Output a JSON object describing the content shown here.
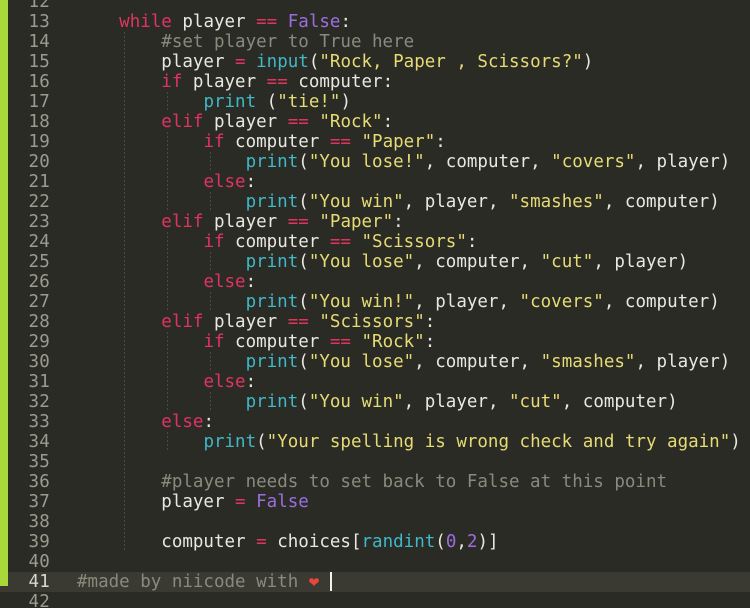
{
  "editor": {
    "language": "Python",
    "theme_name": "dark-olive",
    "background_color": "#2b2b26",
    "active_line_background": "#3a3a33",
    "accent_bar_color": "#a8d839",
    "gutter_color": "#9b9b8e",
    "caret_color": "#f2f2ea",
    "active_line_number": 41,
    "first_visible_line": 12,
    "last_visible_line": 42,
    "palette": {
      "plain": "#e8e8e0",
      "keyword": "#e0345e",
      "builtin": "#3fb8c8",
      "string": "#e6db74",
      "number": "#9b6ee0",
      "constant": "#9b6ee0",
      "operator": "#e0345e",
      "comment": "#8a8a7c",
      "emoji": "#e8453c"
    }
  },
  "lines": [
    {
      "number": "12",
      "indent_guides": [],
      "tokens": []
    },
    {
      "number": "13",
      "indent_guides": [],
      "tokens": [
        {
          "t": "plain",
          "v": "    "
        },
        {
          "t": "keyword",
          "v": "while"
        },
        {
          "t": "plain",
          "v": " player "
        },
        {
          "t": "operator",
          "v": "=="
        },
        {
          "t": "plain",
          "v": " "
        },
        {
          "t": "constant",
          "v": "False"
        },
        {
          "t": "punct",
          "v": ":"
        }
      ]
    },
    {
      "number": "14",
      "indent_guides": [
        124
      ],
      "tokens": [
        {
          "t": "plain",
          "v": "        "
        },
        {
          "t": "comment",
          "v": "#set player to True here"
        }
      ]
    },
    {
      "number": "15",
      "indent_guides": [
        124
      ],
      "tokens": [
        {
          "t": "plain",
          "v": "        player "
        },
        {
          "t": "operator",
          "v": "="
        },
        {
          "t": "plain",
          "v": " "
        },
        {
          "t": "builtin",
          "v": "input"
        },
        {
          "t": "punct",
          "v": "("
        },
        {
          "t": "string",
          "v": "\"Rock, Paper , Scissors?\""
        },
        {
          "t": "punct",
          "v": ")"
        }
      ]
    },
    {
      "number": "16",
      "indent_guides": [
        124
      ],
      "tokens": [
        {
          "t": "plain",
          "v": "        "
        },
        {
          "t": "keyword",
          "v": "if"
        },
        {
          "t": "plain",
          "v": " player "
        },
        {
          "t": "operator",
          "v": "=="
        },
        {
          "t": "plain",
          "v": " computer"
        },
        {
          "t": "punct",
          "v": ":"
        }
      ]
    },
    {
      "number": "17",
      "indent_guides": [
        124,
        167
      ],
      "tokens": [
        {
          "t": "plain",
          "v": "            "
        },
        {
          "t": "builtin",
          "v": "print"
        },
        {
          "t": "plain",
          "v": " "
        },
        {
          "t": "punct",
          "v": "("
        },
        {
          "t": "string",
          "v": "\"tie!\""
        },
        {
          "t": "punct",
          "v": ")"
        }
      ]
    },
    {
      "number": "18",
      "indent_guides": [
        124
      ],
      "tokens": [
        {
          "t": "plain",
          "v": "        "
        },
        {
          "t": "keyword",
          "v": "elif"
        },
        {
          "t": "plain",
          "v": " player "
        },
        {
          "t": "operator",
          "v": "=="
        },
        {
          "t": "plain",
          "v": " "
        },
        {
          "t": "string",
          "v": "\"Rock\""
        },
        {
          "t": "punct",
          "v": ":"
        }
      ]
    },
    {
      "number": "19",
      "indent_guides": [
        124,
        167
      ],
      "tokens": [
        {
          "t": "plain",
          "v": "            "
        },
        {
          "t": "keyword",
          "v": "if"
        },
        {
          "t": "plain",
          "v": " computer "
        },
        {
          "t": "operator",
          "v": "=="
        },
        {
          "t": "plain",
          "v": " "
        },
        {
          "t": "string",
          "v": "\"Paper\""
        },
        {
          "t": "punct",
          "v": ":"
        }
      ]
    },
    {
      "number": "20",
      "indent_guides": [
        124,
        167,
        210
      ],
      "tokens": [
        {
          "t": "plain",
          "v": "                "
        },
        {
          "t": "builtin",
          "v": "print"
        },
        {
          "t": "punct",
          "v": "("
        },
        {
          "t": "string",
          "v": "\"You lose!\""
        },
        {
          "t": "punct",
          "v": ", "
        },
        {
          "t": "plain",
          "v": "computer"
        },
        {
          "t": "punct",
          "v": ", "
        },
        {
          "t": "string",
          "v": "\"covers\""
        },
        {
          "t": "punct",
          "v": ", "
        },
        {
          "t": "plain",
          "v": "player"
        },
        {
          "t": "punct",
          "v": ")"
        }
      ]
    },
    {
      "number": "21",
      "indent_guides": [
        124,
        167
      ],
      "tokens": [
        {
          "t": "plain",
          "v": "            "
        },
        {
          "t": "keyword",
          "v": "else"
        },
        {
          "t": "punct",
          "v": ":"
        }
      ]
    },
    {
      "number": "22",
      "indent_guides": [
        124,
        167,
        210
      ],
      "tokens": [
        {
          "t": "plain",
          "v": "                "
        },
        {
          "t": "builtin",
          "v": "print"
        },
        {
          "t": "punct",
          "v": "("
        },
        {
          "t": "string",
          "v": "\"You win\""
        },
        {
          "t": "punct",
          "v": ", "
        },
        {
          "t": "plain",
          "v": "player"
        },
        {
          "t": "punct",
          "v": ", "
        },
        {
          "t": "string",
          "v": "\"smashes\""
        },
        {
          "t": "punct",
          "v": ", "
        },
        {
          "t": "plain",
          "v": "computer"
        },
        {
          "t": "punct",
          "v": ")"
        }
      ]
    },
    {
      "number": "23",
      "indent_guides": [
        124
      ],
      "tokens": [
        {
          "t": "plain",
          "v": "        "
        },
        {
          "t": "keyword",
          "v": "elif"
        },
        {
          "t": "plain",
          "v": " player "
        },
        {
          "t": "operator",
          "v": "=="
        },
        {
          "t": "plain",
          "v": " "
        },
        {
          "t": "string",
          "v": "\"Paper\""
        },
        {
          "t": "punct",
          "v": ":"
        }
      ]
    },
    {
      "number": "24",
      "indent_guides": [
        124,
        167
      ],
      "tokens": [
        {
          "t": "plain",
          "v": "            "
        },
        {
          "t": "keyword",
          "v": "if"
        },
        {
          "t": "plain",
          "v": " computer "
        },
        {
          "t": "operator",
          "v": "=="
        },
        {
          "t": "plain",
          "v": " "
        },
        {
          "t": "string",
          "v": "\"Scissors\""
        },
        {
          "t": "punct",
          "v": ":"
        }
      ]
    },
    {
      "number": "25",
      "indent_guides": [
        124,
        167,
        210
      ],
      "tokens": [
        {
          "t": "plain",
          "v": "                "
        },
        {
          "t": "builtin",
          "v": "print"
        },
        {
          "t": "punct",
          "v": "("
        },
        {
          "t": "string",
          "v": "\"You lose\""
        },
        {
          "t": "punct",
          "v": ", "
        },
        {
          "t": "plain",
          "v": "computer"
        },
        {
          "t": "punct",
          "v": ", "
        },
        {
          "t": "string",
          "v": "\"cut\""
        },
        {
          "t": "punct",
          "v": ", "
        },
        {
          "t": "plain",
          "v": "player"
        },
        {
          "t": "punct",
          "v": ")"
        }
      ]
    },
    {
      "number": "26",
      "indent_guides": [
        124,
        167
      ],
      "tokens": [
        {
          "t": "plain",
          "v": "            "
        },
        {
          "t": "keyword",
          "v": "else"
        },
        {
          "t": "punct",
          "v": ":"
        }
      ]
    },
    {
      "number": "27",
      "indent_guides": [
        124,
        167,
        210
      ],
      "tokens": [
        {
          "t": "plain",
          "v": "                "
        },
        {
          "t": "builtin",
          "v": "print"
        },
        {
          "t": "punct",
          "v": "("
        },
        {
          "t": "string",
          "v": "\"You win!\""
        },
        {
          "t": "punct",
          "v": ", "
        },
        {
          "t": "plain",
          "v": "player"
        },
        {
          "t": "punct",
          "v": ", "
        },
        {
          "t": "string",
          "v": "\"covers\""
        },
        {
          "t": "punct",
          "v": ", "
        },
        {
          "t": "plain",
          "v": "computer"
        },
        {
          "t": "punct",
          "v": ")"
        }
      ]
    },
    {
      "number": "28",
      "indent_guides": [
        124
      ],
      "tokens": [
        {
          "t": "plain",
          "v": "        "
        },
        {
          "t": "keyword",
          "v": "elif"
        },
        {
          "t": "plain",
          "v": " player "
        },
        {
          "t": "operator",
          "v": "=="
        },
        {
          "t": "plain",
          "v": " "
        },
        {
          "t": "string",
          "v": "\"Scissors\""
        },
        {
          "t": "punct",
          "v": ":"
        }
      ]
    },
    {
      "number": "29",
      "indent_guides": [
        124,
        167
      ],
      "tokens": [
        {
          "t": "plain",
          "v": "            "
        },
        {
          "t": "keyword",
          "v": "if"
        },
        {
          "t": "plain",
          "v": " computer "
        },
        {
          "t": "operator",
          "v": "=="
        },
        {
          "t": "plain",
          "v": " "
        },
        {
          "t": "string",
          "v": "\"Rock\""
        },
        {
          "t": "punct",
          "v": ":"
        }
      ]
    },
    {
      "number": "30",
      "indent_guides": [
        124,
        167,
        210
      ],
      "tokens": [
        {
          "t": "plain",
          "v": "                "
        },
        {
          "t": "builtin",
          "v": "print"
        },
        {
          "t": "punct",
          "v": "("
        },
        {
          "t": "string",
          "v": "\"You lose\""
        },
        {
          "t": "punct",
          "v": ", "
        },
        {
          "t": "plain",
          "v": "computer"
        },
        {
          "t": "punct",
          "v": ", "
        },
        {
          "t": "string",
          "v": "\"smashes\""
        },
        {
          "t": "punct",
          "v": ", "
        },
        {
          "t": "plain",
          "v": "player"
        },
        {
          "t": "punct",
          "v": ")"
        }
      ]
    },
    {
      "number": "31",
      "indent_guides": [
        124,
        167
      ],
      "tokens": [
        {
          "t": "plain",
          "v": "            "
        },
        {
          "t": "keyword",
          "v": "else"
        },
        {
          "t": "punct",
          "v": ":"
        }
      ]
    },
    {
      "number": "32",
      "indent_guides": [
        124,
        167,
        210
      ],
      "tokens": [
        {
          "t": "plain",
          "v": "                "
        },
        {
          "t": "builtin",
          "v": "print"
        },
        {
          "t": "punct",
          "v": "("
        },
        {
          "t": "string",
          "v": "\"You win\""
        },
        {
          "t": "punct",
          "v": ", "
        },
        {
          "t": "plain",
          "v": "player"
        },
        {
          "t": "punct",
          "v": ", "
        },
        {
          "t": "string",
          "v": "\"cut\""
        },
        {
          "t": "punct",
          "v": ", "
        },
        {
          "t": "plain",
          "v": "computer"
        },
        {
          "t": "punct",
          "v": ")"
        }
      ]
    },
    {
      "number": "33",
      "indent_guides": [
        124
      ],
      "tokens": [
        {
          "t": "plain",
          "v": "        "
        },
        {
          "t": "keyword",
          "v": "else"
        },
        {
          "t": "punct",
          "v": ":"
        }
      ]
    },
    {
      "number": "34",
      "indent_guides": [
        124,
        167
      ],
      "tokens": [
        {
          "t": "plain",
          "v": "            "
        },
        {
          "t": "builtin",
          "v": "print"
        },
        {
          "t": "punct",
          "v": "("
        },
        {
          "t": "string",
          "v": "\"Your spelling is wrong check and try again\""
        },
        {
          "t": "punct",
          "v": ")"
        }
      ]
    },
    {
      "number": "35",
      "indent_guides": [
        124
      ],
      "tokens": []
    },
    {
      "number": "36",
      "indent_guides": [
        124
      ],
      "tokens": [
        {
          "t": "plain",
          "v": "        "
        },
        {
          "t": "comment",
          "v": "#player needs to set back to False at this point"
        }
      ]
    },
    {
      "number": "37",
      "indent_guides": [
        124
      ],
      "tokens": [
        {
          "t": "plain",
          "v": "        player "
        },
        {
          "t": "operator",
          "v": "="
        },
        {
          "t": "plain",
          "v": " "
        },
        {
          "t": "constant",
          "v": "False"
        }
      ]
    },
    {
      "number": "38",
      "indent_guides": [
        124
      ],
      "tokens": []
    },
    {
      "number": "39",
      "indent_guides": [
        124
      ],
      "tokens": [
        {
          "t": "plain",
          "v": "        computer "
        },
        {
          "t": "operator",
          "v": "="
        },
        {
          "t": "plain",
          "v": " choices"
        },
        {
          "t": "punct",
          "v": "["
        },
        {
          "t": "builtin",
          "v": "randint"
        },
        {
          "t": "punct",
          "v": "("
        },
        {
          "t": "number",
          "v": "0"
        },
        {
          "t": "punct",
          "v": ","
        },
        {
          "t": "number",
          "v": "2"
        },
        {
          "t": "punct",
          "v": ")]"
        }
      ]
    },
    {
      "number": "40",
      "indent_guides": [],
      "tokens": []
    },
    {
      "number": "41",
      "indent_guides": [],
      "active": true,
      "tokens": [
        {
          "t": "comment",
          "v": "#made by niicode with "
        },
        {
          "t": "emoji",
          "v": "❤"
        },
        {
          "t": "comment",
          "v": " "
        }
      ]
    },
    {
      "number": "42",
      "indent_guides": [],
      "tokens": []
    }
  ],
  "caret": {
    "line": 41,
    "column": 22,
    "visible": true
  }
}
